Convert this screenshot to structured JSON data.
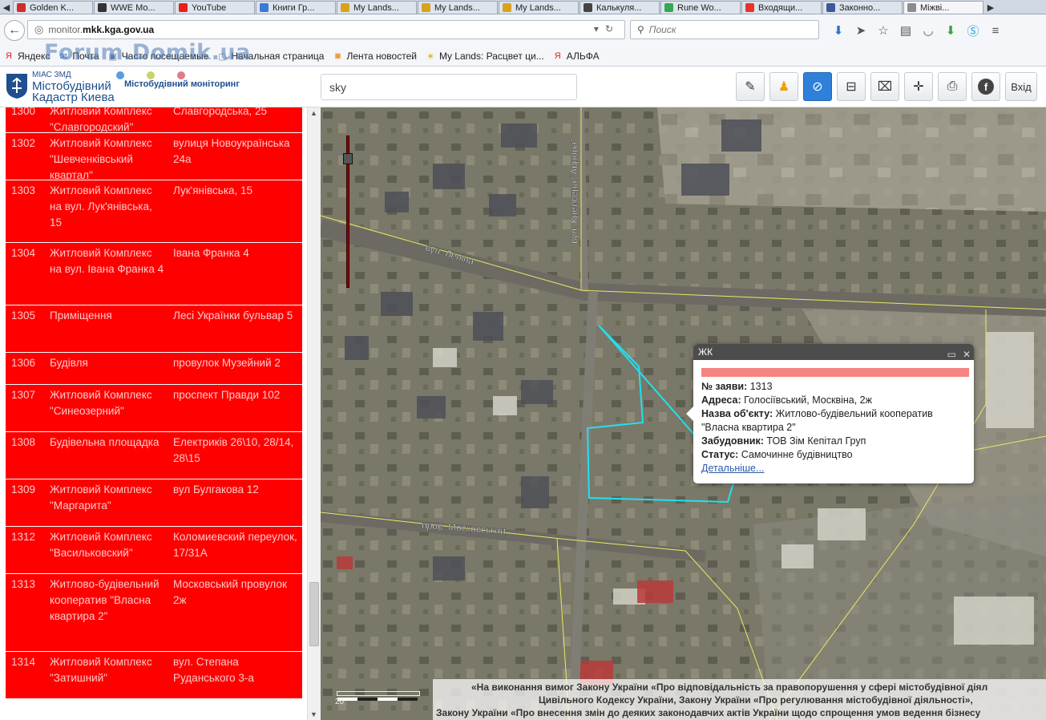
{
  "browser": {
    "tabs": [
      {
        "label": "Golden K...",
        "color": "#d12b2b"
      },
      {
        "label": "WWE Mo...",
        "color": "#333333"
      },
      {
        "label": "YouTube",
        "color": "#e62117"
      },
      {
        "label": "Книги Гр...",
        "color": "#3d7ad6"
      },
      {
        "label": "My Lands...",
        "color": "#d9a11c"
      },
      {
        "label": "My Lands...",
        "color": "#d9a11c"
      },
      {
        "label": "My Lands...",
        "color": "#d9a11c"
      },
      {
        "label": "Калькуля...",
        "color": "#444444"
      },
      {
        "label": "Rune Wo...",
        "color": "#34a853"
      },
      {
        "label": "Входящи...",
        "color": "#e8322f"
      },
      {
        "label": "Законно...",
        "color": "#3b5998"
      },
      {
        "label": "Міжві...",
        "color": "#8c8c8c"
      }
    ],
    "url_prefix": "monitor.",
    "url_domain": "mkk.kga.gov.ua",
    "search_placeholder": "Поиск",
    "bookmarks": [
      {
        "label": "Яндекс",
        "icon": "yandex-icon"
      },
      {
        "label": "Почта",
        "icon": "mail-icon"
      },
      {
        "label": "Часто посещаемые",
        "icon": "folder-icon"
      },
      {
        "label": "Начальная страница",
        "icon": "page-icon"
      },
      {
        "label": "Лента новостей",
        "icon": "rss-icon"
      },
      {
        "label": "My Lands: Расцвет ци...",
        "icon": "game-icon"
      },
      {
        "label": "АЛЬФА",
        "icon": "alfa-icon"
      }
    ],
    "watermark": "Forum.Domik.ua"
  },
  "app": {
    "brand_small": "МІАС ЗМД",
    "brand_line1": "Містобудівний",
    "brand_line2": "Кадастр Киева",
    "brand_subtitle": "Містобудівний моніторинг",
    "search_value": "sky",
    "exit_label": "Вхід",
    "toolbar_icons": [
      "edit-icon",
      "pegman-icon",
      "compass-icon",
      "ruler-icon",
      "area-measure-icon",
      "crosshair-icon",
      "print-icon",
      "facebook-icon"
    ],
    "colors": {
      "list_row": "#fe0000",
      "active_tool": "#2f80d8",
      "parcel_outline": "#22e0f0"
    }
  },
  "list": [
    {
      "num": "1300",
      "name": "Житловий Комплекс \"Славгородский\"",
      "addr": "Славгородська, 25"
    },
    {
      "num": "1302",
      "name": "Житловий Комплекс \"Шевченківський квартал\"",
      "addr": "вулиця Новоукраїнська 24а"
    },
    {
      "num": "1303",
      "name": "Житловий Комплекс на вул. Лук'янівська, 15",
      "addr": "Лук'янівська, 15"
    },
    {
      "num": "1304",
      "name": "Житловий Комплекс на вул. Івана Франка 4",
      "addr": "Івана Франка 4"
    },
    {
      "num": "1305",
      "name": "Приміщення",
      "addr": "Лесі Українки бульвар 5"
    },
    {
      "num": "1306",
      "name": "Будівля",
      "addr": "провулок Музейний 2"
    },
    {
      "num": "1307",
      "name": "Житловий Комплекс \"Синеозерний\"",
      "addr": "проспект Правди 102"
    },
    {
      "num": "1308",
      "name": "Будівельна площадка",
      "addr": "Електриків 26\\10, 28/14, 28\\15"
    },
    {
      "num": "1309",
      "name": "Житловий Комплекс \"Маргарита\"",
      "addr": "вул Булгакова 12"
    },
    {
      "num": "1312",
      "name": "Житловий Комплекс \"Васильковский\"",
      "addr": "Коломиевский переулок, 17/31А"
    },
    {
      "num": "1313",
      "name": "Житлово-будівельний кооператив \"Власна квартира 2\"",
      "addr": "Московський провулок 2ж"
    },
    {
      "num": "1314",
      "name": "Житловий Комплекс \"Затишний\"",
      "addr": "вул. Степана Руданського 3-а"
    }
  ],
  "map": {
    "street_labels": [
      "вул. Леніна",
      "вул. Крейсера \"Аврора\"",
      "пров. Московський"
    ],
    "scale_text": "20",
    "legal_lines": [
      "«На виконання вимог Закону України «Про відповідальність за правопорушення у сфері містобудівної діял",
      "Цивільного Кодексу України, Закону України «Про регулювання містобудівної діяльності»,",
      "Закону України «Про внесення змін до деяких законодавчих актів України щодо спрощення умов ведення бізнесу"
    ]
  },
  "popup": {
    "title": "ЖК",
    "num_label": "№ заяви:",
    "num_value": "1313",
    "addr_label": "Адреса:",
    "addr_value": "Голосіївський, Москвіна, 2ж",
    "name_label": "Назва об'єкту:",
    "name_value": "Житлово-будівельний кооператив \"Власна квартира 2\"",
    "dev_label": "Забудовник:",
    "dev_value": "ТОВ Зім Кепітал Груп",
    "status_label": "Статус:",
    "status_value": "Самочинне будівництво",
    "details_link": "Детальніше..."
  }
}
